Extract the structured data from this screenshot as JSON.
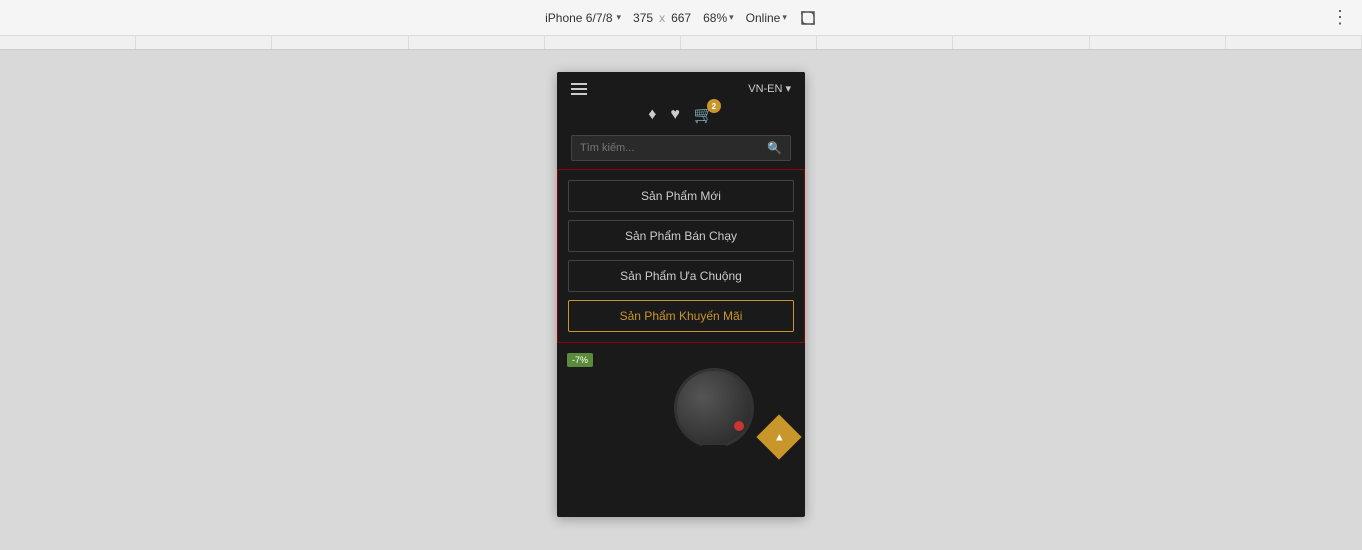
{
  "toolbar": {
    "device": "iPhone 6/7/8",
    "chevron": "▾",
    "width": "375",
    "cross": "x",
    "height": "667",
    "zoom": "68%",
    "zoom_chevron": "▾",
    "online": "Online",
    "online_chevron": "▾",
    "more_icon": "⋮"
  },
  "header": {
    "lang": "VN-EN",
    "lang_chevron": "▾",
    "search_placeholder": "Tìm kiếm...",
    "cart_count": "2"
  },
  "nav": {
    "items": [
      {
        "label": "Sản Phẩm Mới"
      },
      {
        "label": "Sản Phẩm Bán Chạy"
      },
      {
        "label": "Sản Phẩm Ưa Chuộng"
      },
      {
        "label": "Sản Phẩm Khuyến Mãi"
      }
    ]
  },
  "product": {
    "discount": "-7%"
  },
  "icons": {
    "hamburger": "☰",
    "user": "♠",
    "heart": "♥",
    "cart": "🛒",
    "search": "🔍",
    "rotate": "⤢"
  }
}
